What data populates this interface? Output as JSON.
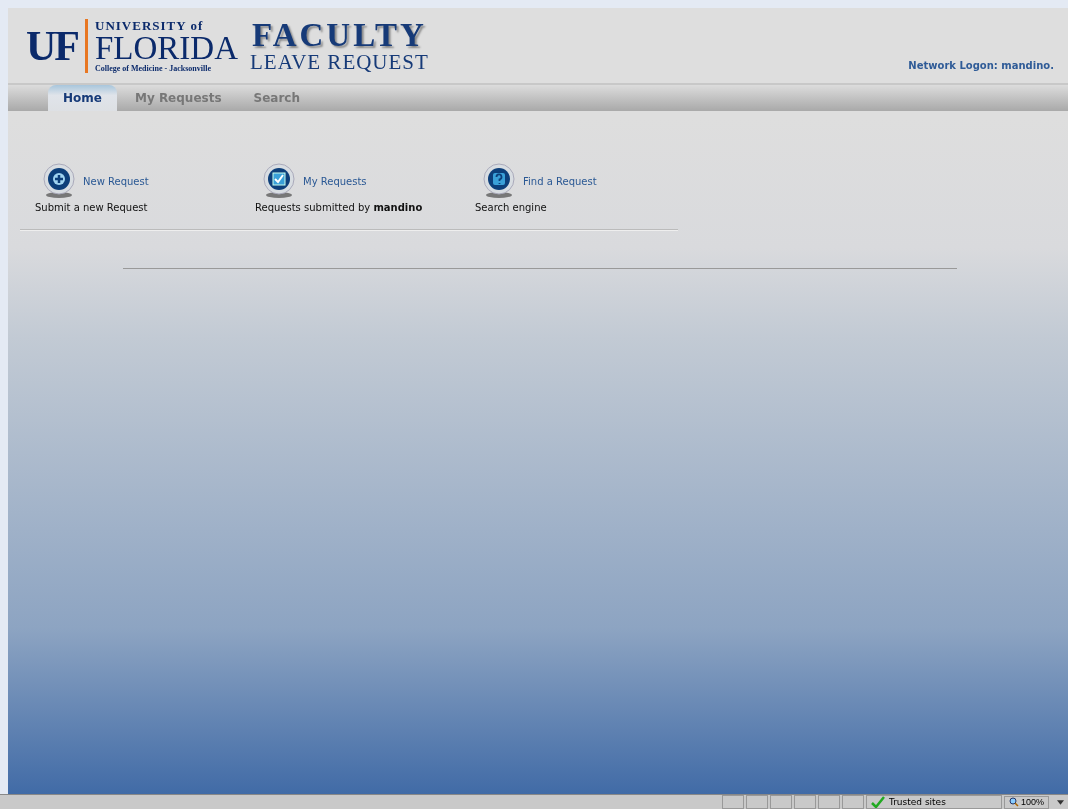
{
  "header": {
    "logo_mark": "UF",
    "logo_university": "UNIVERSITY of",
    "logo_florida": "FLORIDA",
    "logo_college": "College of Medicine - Jacksonville",
    "app_title": "FACULTY",
    "app_subtitle": "LEAVE REQUEST",
    "network_logon": "Network Logon: mandino."
  },
  "tabs": [
    {
      "label": "Home",
      "selected": true
    },
    {
      "label": "My Requests",
      "selected": false
    },
    {
      "label": "Search",
      "selected": false
    }
  ],
  "actions": [
    {
      "kind": "plus",
      "link": "New Request",
      "description": "Submit a new Request"
    },
    {
      "kind": "check",
      "link": "My Requests",
      "description": "Requests submitted by **mandino**"
    },
    {
      "kind": "question",
      "link": "Find a Request",
      "description": "Search engine"
    }
  ],
  "status_bar": {
    "zone": "Trusted sites",
    "zoom": "100%"
  }
}
